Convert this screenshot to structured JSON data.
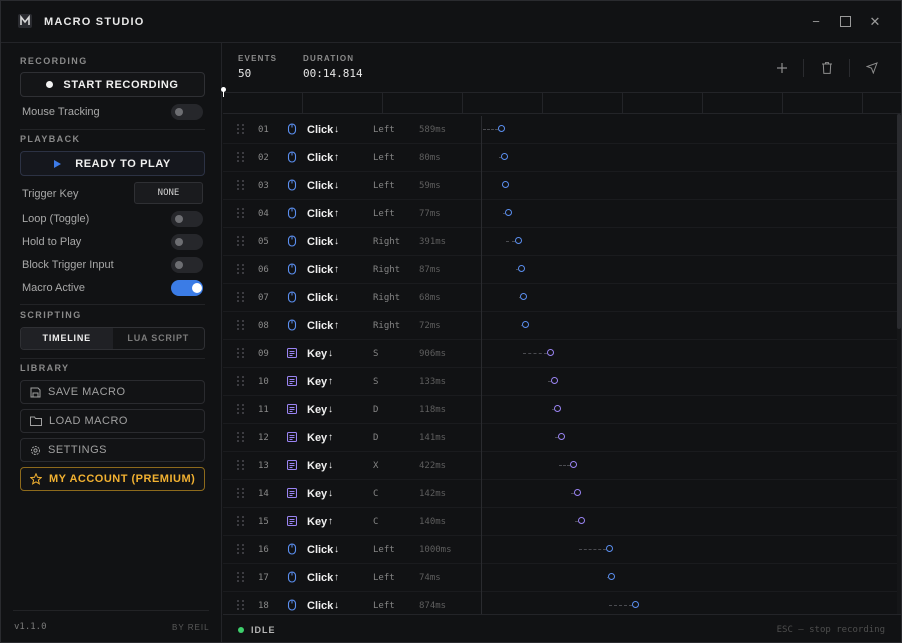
{
  "app": {
    "title": "MACRO STUDIO"
  },
  "window_controls": {
    "minimize": "−",
    "maximize": "☐",
    "close": "✕"
  },
  "sidebar": {
    "recording": {
      "section_label": "RECORDING",
      "start_button": "START RECORDING",
      "mouse_tracking_label": "Mouse Tracking",
      "mouse_tracking_on": false
    },
    "playback": {
      "section_label": "PLAYBACK",
      "play_button": "READY TO PLAY",
      "trigger_key_label": "Trigger Key",
      "trigger_key_value": "NONE",
      "toggles": [
        {
          "label": "Loop (Toggle)",
          "on": false
        },
        {
          "label": "Hold to Play",
          "on": false
        },
        {
          "label": "Block Trigger Input",
          "on": false
        },
        {
          "label": "Macro Active",
          "on": true
        }
      ]
    },
    "scripting": {
      "section_label": "SCRIPTING",
      "tabs": [
        "TIMELINE",
        "LUA SCRIPT"
      ],
      "active_tab": "TIMELINE"
    },
    "library": {
      "section_label": "LIBRARY",
      "save": "SAVE MACRO",
      "load": "LOAD MACRO",
      "settings": "SETTINGS",
      "account": "MY ACCOUNT (PREMIUM)"
    },
    "footer": {
      "version": "v1.1.0",
      "byline": "BY REIL"
    }
  },
  "stats": {
    "events_label": "EVENTS",
    "events_value": "50",
    "duration_label": "DURATION",
    "duration_value": "00:14.814"
  },
  "toolbar": {
    "add_icon": "plus-icon",
    "delete_icon": "trash-icon",
    "select_icon": "cursor-icon"
  },
  "colors": {
    "accent": "#3b7ce6",
    "premium": "#f1b131",
    "mouse_node": "#5b8ff0",
    "key_node": "#9a84f3",
    "idle": "#3ecf6c"
  },
  "events": [
    {
      "index": "01",
      "kind": "mouse",
      "type": "Click",
      "arrow": "↓",
      "detail": "Left",
      "delay": "589ms"
    },
    {
      "index": "02",
      "kind": "mouse",
      "type": "Click",
      "arrow": "↑",
      "detail": "Left",
      "delay": "80ms"
    },
    {
      "index": "03",
      "kind": "mouse",
      "type": "Click",
      "arrow": "↓",
      "detail": "Left",
      "delay": "59ms"
    },
    {
      "index": "04",
      "kind": "mouse",
      "type": "Click",
      "arrow": "↑",
      "detail": "Left",
      "delay": "77ms"
    },
    {
      "index": "05",
      "kind": "mouse",
      "type": "Click",
      "arrow": "↓",
      "detail": "Right",
      "delay": "391ms"
    },
    {
      "index": "06",
      "kind": "mouse",
      "type": "Click",
      "arrow": "↑",
      "detail": "Right",
      "delay": "87ms"
    },
    {
      "index": "07",
      "kind": "mouse",
      "type": "Click",
      "arrow": "↓",
      "detail": "Right",
      "delay": "68ms"
    },
    {
      "index": "08",
      "kind": "mouse",
      "type": "Click",
      "arrow": "↑",
      "detail": "Right",
      "delay": "72ms"
    },
    {
      "index": "09",
      "kind": "key",
      "type": "Key",
      "arrow": "↓",
      "detail": "S",
      "delay": "906ms"
    },
    {
      "index": "10",
      "kind": "key",
      "type": "Key",
      "arrow": "↑",
      "detail": "S",
      "delay": "133ms"
    },
    {
      "index": "11",
      "kind": "key",
      "type": "Key",
      "arrow": "↓",
      "detail": "D",
      "delay": "118ms"
    },
    {
      "index": "12",
      "kind": "key",
      "type": "Key",
      "arrow": "↑",
      "detail": "D",
      "delay": "141ms"
    },
    {
      "index": "13",
      "kind": "key",
      "type": "Key",
      "arrow": "↓",
      "detail": "X",
      "delay": "422ms"
    },
    {
      "index": "14",
      "kind": "key",
      "type": "Key",
      "arrow": "↓",
      "detail": "C",
      "delay": "142ms"
    },
    {
      "index": "15",
      "kind": "key",
      "type": "Key",
      "arrow": "↑",
      "detail": "C",
      "delay": "140ms"
    },
    {
      "index": "16",
      "kind": "mouse",
      "type": "Click",
      "arrow": "↓",
      "detail": "Left",
      "delay": "1000ms"
    },
    {
      "index": "17",
      "kind": "mouse",
      "type": "Click",
      "arrow": "↑",
      "detail": "Left",
      "delay": "74ms"
    },
    {
      "index": "18",
      "kind": "mouse",
      "type": "Click",
      "arrow": "↓",
      "detail": "Left",
      "delay": "874ms"
    }
  ],
  "status": {
    "state": "IDLE",
    "hint": "ESC — stop recording"
  }
}
